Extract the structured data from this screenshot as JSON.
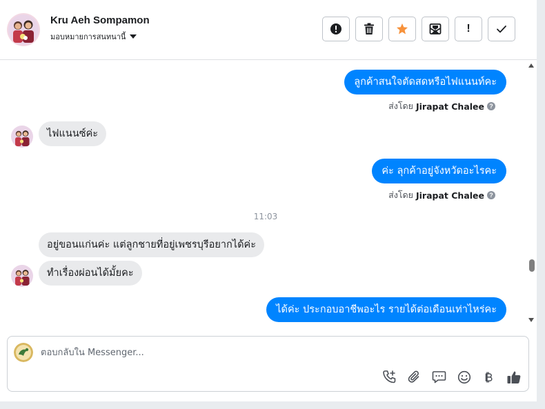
{
  "header": {
    "contact_name": "Kru Aeh Sompamon",
    "assign_label": "มอบหมายการสนทนานี้"
  },
  "toolbar": {
    "report_icon": "alert-circle-icon",
    "delete_icon": "trash-icon",
    "star_icon": "star-icon",
    "unread_icon": "mark-unread-icon",
    "spam_label": "!",
    "done_icon": "checkmark-icon",
    "star_color": "#f7923b"
  },
  "messages": {
    "m1": "ลูกค้าสนใจตัดสดหรือไฟแนนท์คะ",
    "m1_sent_by_prefix": "ส่งโดย",
    "m1_sender": "Jirapat Chalee",
    "m2": "ไฟแนนซ์ค่ะ",
    "m3": "ค่ะ ลุกค้าอยู่จังหวัดอะไรคะ",
    "m3_sent_by_prefix": "ส่งโดย",
    "m3_sender": "Jirapat Chalee",
    "timestamp": "11:03",
    "m4": "อยู่ขอนแก่นค่ะ  แต่ลูกชายที่อยู่เพชรบุรีอยากได้ค่ะ",
    "m5": "ทำเรื่องผ่อนได้มั้ยคะ",
    "m6": "ได้ค่ะ ประกอบอาชีพอะไร รายได้ต่อเดือนเท่าไหร่คะ",
    "help_glyph": "?"
  },
  "composer": {
    "placeholder": "ตอบกลับใน Messenger..."
  },
  "colors": {
    "outgoing_bubble": "#0084ff",
    "incoming_bubble": "#e9eaec"
  }
}
